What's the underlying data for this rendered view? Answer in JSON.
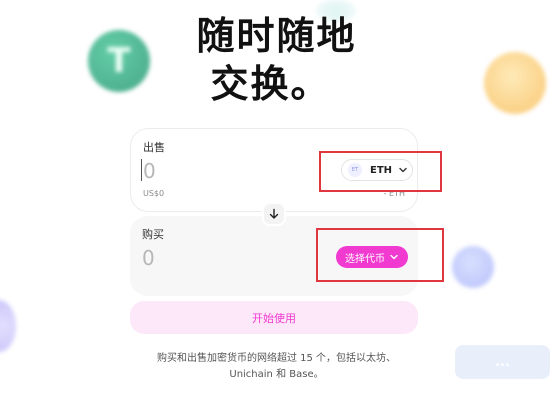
{
  "hero": {
    "line1": "随时随地",
    "line2": "交换。"
  },
  "sell": {
    "label": "出售",
    "amount": "0",
    "fiat_value": "US$0",
    "token_value": "- ETH",
    "token": {
      "icon_text": "ET",
      "symbol": "ETH"
    }
  },
  "buy": {
    "label": "购买",
    "amount": "0",
    "select_label": "选择代币"
  },
  "cta_label": "开始使用",
  "footnote": {
    "line1": "购买和出售加密货币的网络超过 15 个，包括以太坊、",
    "line2": "Unichain 和 Base。"
  },
  "decor": {
    "usdt_symbol": "T",
    "watermark_text": "..."
  },
  "colors": {
    "accent_pink": "#f03ad0",
    "highlight_red": "#e0373f",
    "cta_bg": "#fde8fa"
  }
}
